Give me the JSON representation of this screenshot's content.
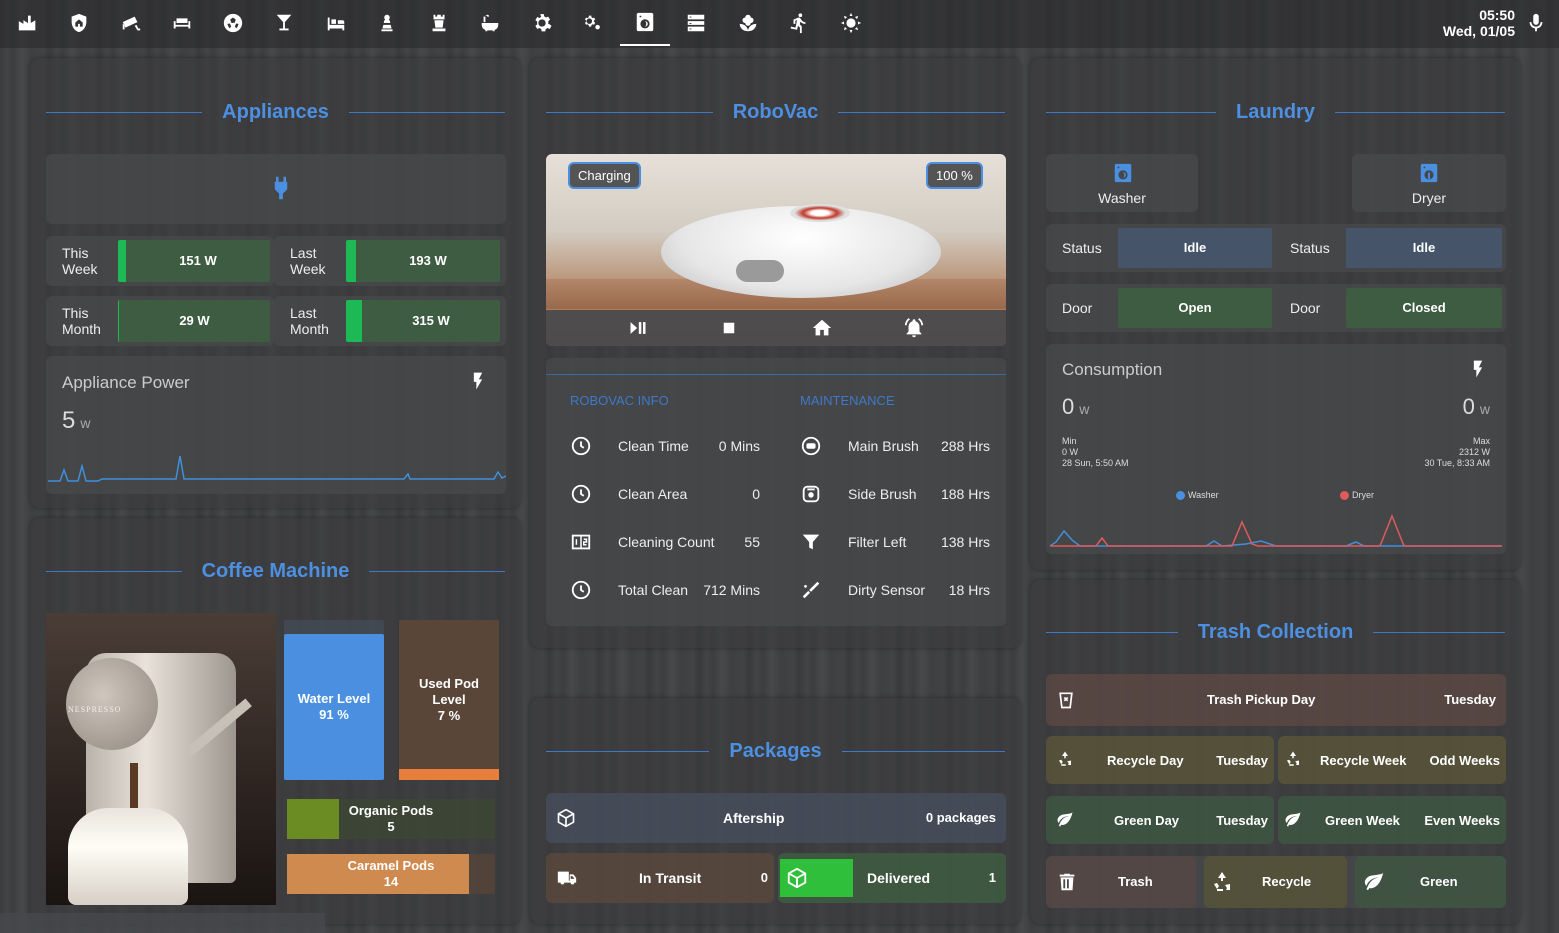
{
  "topbar": {
    "time": "05:50",
    "date": "Wed, 01/05",
    "tabs": [
      "factory-icon",
      "shield-home-icon",
      "cctv-icon",
      "sofa-icon",
      "soccer-icon",
      "glass-cocktail-icon",
      "bed-icon",
      "chess-pawn-icon",
      "chess-rook-icon",
      "bathtub-icon",
      "cog-icon",
      "cogs-icon",
      "washing-machine-icon",
      "server-icon",
      "flower-icon",
      "run-icon",
      "weather-sunny-icon"
    ],
    "active_tab": 12
  },
  "colors": {
    "accent": "#4d8fe0",
    "green": "#1db954",
    "dark_green": "#3e5c41",
    "blue": "#4a8fe0",
    "orange": "#e87e3c",
    "brown_pod": "#ce8a4f",
    "olive": "#6b8b23"
  },
  "appliances": {
    "title": "Appliances",
    "this_week_label": "This\nWeek",
    "this_week": "151 W",
    "last_week_label": "Last\nWeek",
    "last_week": "193 W",
    "this_month_label": "This\nMonth",
    "this_month": "29 W",
    "last_month_label": "Last\nMonth",
    "last_month": "315 W",
    "power_title": "Appliance Power",
    "power_value": "5",
    "power_unit": "w"
  },
  "coffee": {
    "title": "Coffee Machine",
    "brand": "NESPRESSO",
    "water_label": "Water Level",
    "water_value": "91 %",
    "water_level": 0.91,
    "used_label": "Used Pod Level",
    "used_value": "7 %",
    "used_level": 0.07,
    "organic_label": "Organic Pods",
    "organic_value": "5",
    "caramel_label": "Caramel Pods",
    "caramel_value": "14"
  },
  "robovac": {
    "title": "RoboVac",
    "status": "Charging",
    "battery": "100 %",
    "info_header": "ROBOVAC INFO",
    "maint_header": "MAINTENANCE",
    "info": [
      {
        "label": "Clean Time",
        "value": "0 Mins"
      },
      {
        "label": "Clean Area",
        "value": "0"
      },
      {
        "label": "Cleaning Count",
        "value": "55"
      },
      {
        "label": "Total Clean",
        "value": "712 Mins"
      }
    ],
    "maintenance": [
      {
        "label": "Main Brush",
        "value": "288 Hrs"
      },
      {
        "label": "Side Brush",
        "value": "188 Hrs"
      },
      {
        "label": "Filter Left",
        "value": "138 Hrs"
      },
      {
        "label": "Dirty Sensor",
        "value": "18 Hrs"
      }
    ]
  },
  "packages": {
    "title": "Packages",
    "aftership_label": "Aftership",
    "aftership_value": "0 packages",
    "transit_label": "In Transit",
    "transit_value": "0",
    "delivered_label": "Delivered",
    "delivered_value": "1"
  },
  "laundry": {
    "title": "Laundry",
    "washer": "Washer",
    "dryer": "Dryer",
    "status_label": "Status",
    "washer_status": "Idle",
    "dryer_status": "Idle",
    "door_label": "Door",
    "washer_door": "Open",
    "dryer_door": "Closed",
    "consumption_title": "Consumption",
    "washer_value": "0",
    "dryer_value": "0",
    "unit": "w",
    "min_label": "Min",
    "min_value": "0 W",
    "min_time": "28 Sun, 5:50 AM",
    "max_label": "Max",
    "max_value": "2312 W",
    "max_time": "30 Tue, 8:33 AM",
    "legend_washer": "Washer",
    "legend_dryer": "Dryer"
  },
  "trash": {
    "title": "Trash Collection",
    "pickup_label": "Trash Pickup Day",
    "pickup_value": "Tuesday",
    "recycle_day_label": "Recycle Day",
    "recycle_day_value": "Tuesday",
    "recycle_week_label": "Recycle Week",
    "recycle_week_value": "Odd Weeks",
    "green_day_label": "Green Day",
    "green_day_value": "Tuesday",
    "green_week_label": "Green Week",
    "green_week_value": "Even Weeks",
    "trash_btn": "Trash",
    "recycle_btn": "Recycle",
    "green_btn": "Green"
  }
}
